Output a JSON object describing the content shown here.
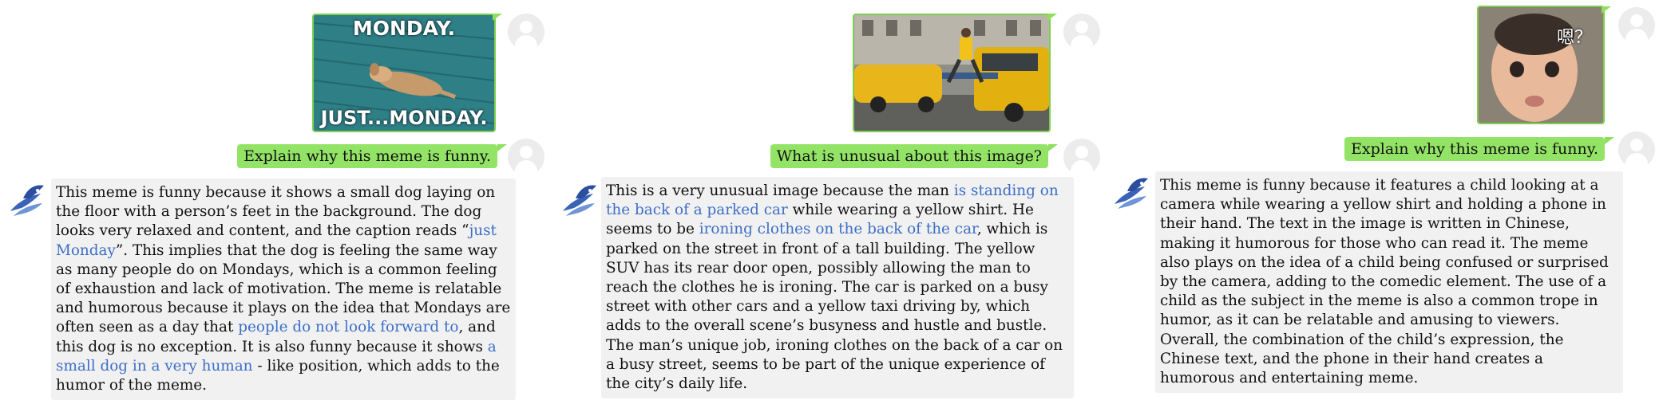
{
  "conversations": [
    {
      "image_caption_top": "MONDAY.",
      "image_caption_bottom": "JUST...MONDAY.",
      "question": "Explain why this meme is funny.",
      "answer": [
        {
          "t": "This meme is funny because it shows a small dog laying on the floor with a person’s feet in the background. The dog looks very relaxed and content, and the caption reads “"
        },
        {
          "t": "just Monday",
          "hl": true
        },
        {
          "t": "”. This implies that the dog is feeling the same way as many people do on Mondays, which is a common feeling of exhaustion and lack of motivation. The meme is relatable and humorous because it plays on the idea that Mondays are often seen as a day that "
        },
        {
          "t": "people do not look forward to",
          "hl": true
        },
        {
          "t": ", and this dog is no exception. It is also funny because it shows "
        },
        {
          "t": "a small dog in a very human",
          "hl": true
        },
        {
          "t": " - like position, which adds to the humor of the meme."
        }
      ]
    },
    {
      "question": "What is unusual about this image?",
      "answer": [
        {
          "t": "This is a very unusual image because the man "
        },
        {
          "t": "is standing on the back of a parked car",
          "hl": true
        },
        {
          "t": " while wearing a yellow shirt. He seems to be "
        },
        {
          "t": "ironing clothes on the back of the car",
          "hl": true
        },
        {
          "t": ", which is parked on the street in front of a tall building. The yellow SUV has its rear door open, possibly allowing the man to reach the clothes he is ironing. The car is parked on a busy street with other cars and a yellow taxi driving by, which adds to the overall scene’s busyness and hustle and bustle. The man’s unique job, ironing clothes on the back of a car on a busy street, seems to be part of the unique experience of the city’s daily life."
        }
      ]
    },
    {
      "image_caption_top": "嗯？",
      "question": "Explain why this meme is funny.",
      "answer": [
        {
          "t": "This meme is funny because it features a child looking at a camera while wearing a yellow shirt and holding a phone in their hand. The text in the image is written in Chinese, making it humorous for those who can read it. The meme also plays on the idea of a child being confused or surprised by the camera, adding to the comedic element. The use of a child as the subject in the meme is also a common trope in humor, as it can be relatable and amusing to viewers. Overall, the combination of the child’s expression, the Chinese text, and the phone in their hand creates a humorous and entertaining meme."
        }
      ]
    }
  ],
  "colors": {
    "question_bubble": "#93e466",
    "answer_bubble": "#f1f1f1",
    "highlight": "#3d6fc7"
  }
}
